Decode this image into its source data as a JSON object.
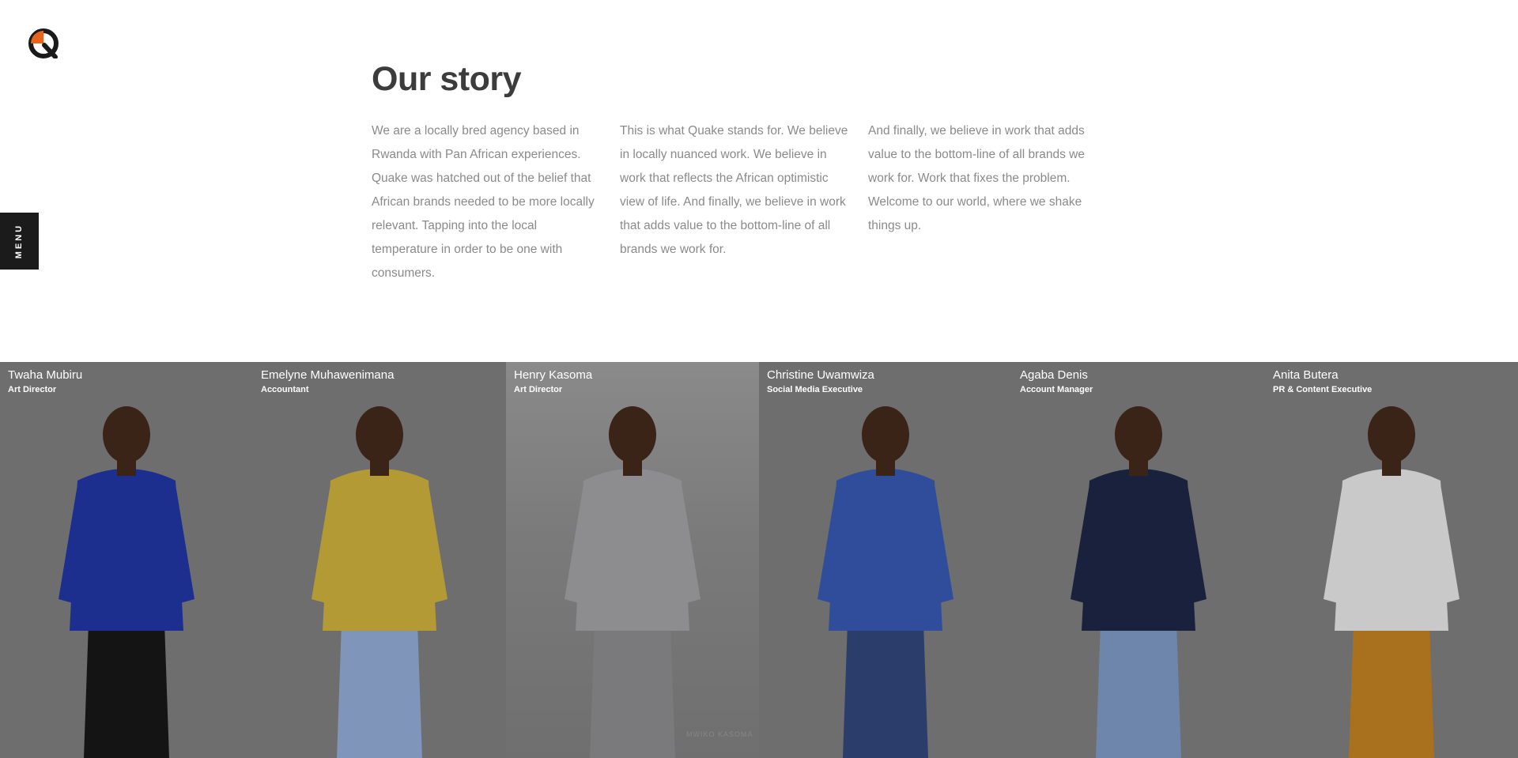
{
  "brand": {
    "accent": "#e8641e",
    "dark": "#1a1a1a"
  },
  "menu": {
    "label": "MENU"
  },
  "story": {
    "title": "Our story",
    "paragraphs": [
      "We are a locally bred agency based in Rwanda with Pan African experiences. Quake was hatched out of the belief that African brands needed to be more locally relevant. Tapping into the local temperature in order to be one with consumers.",
      "This is what Quake stands for. We believe in locally nuanced work. We believe in work that reflects the African optimistic view of life. And finally, we believe in work that adds value to the bottom-line of all brands we work for.",
      "And finally, we believe in work that adds value to the bottom-line of all brands we work for. Work that fixes the problem. Welcome to our world, where we shake things up."
    ]
  },
  "team": [
    {
      "name": "Twaha Mubiru",
      "role": "Art Director",
      "top_color": "#1c2f8f",
      "bottom_color": "#141414"
    },
    {
      "name": "Emelyne Muhawenimana",
      "role": "Accountant",
      "top_color": "#b39a35",
      "bottom_color": "#7f95b9"
    },
    {
      "name": "Henry Kasoma",
      "role": "Art Director",
      "top_color": "#8d8d8f",
      "bottom_color": "#7a7a7c"
    },
    {
      "name": "Christine Uwamwiza",
      "role": "Social Media Executive",
      "top_color": "#2f4d9a",
      "bottom_color": "#2b3d6a"
    },
    {
      "name": "Agaba Denis",
      "role": "Account Manager",
      "top_color": "#19213c",
      "bottom_color": "#6e86ab"
    },
    {
      "name": "Anita Butera",
      "role": "PR & Content Executive",
      "top_color": "#c9c9c9",
      "bottom_color": "#a9701e"
    }
  ],
  "watermark": "MWIKO KASOMA"
}
